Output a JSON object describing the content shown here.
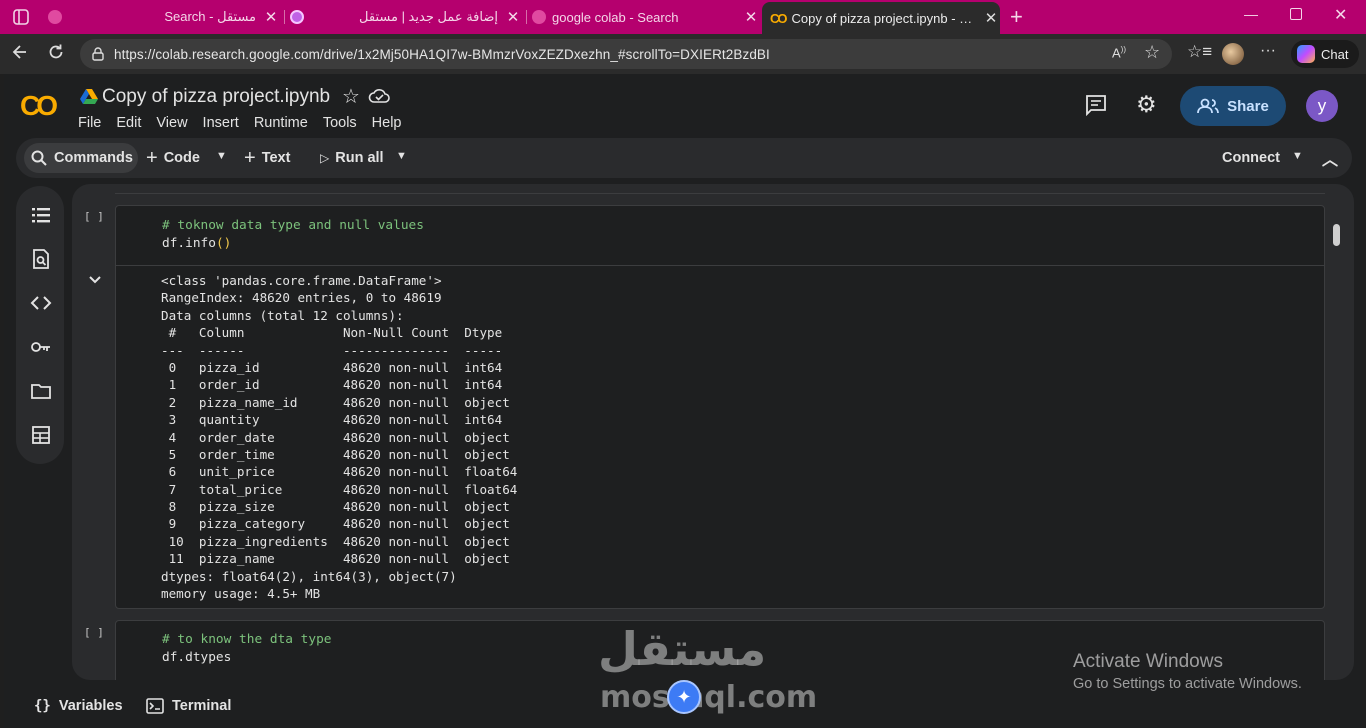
{
  "browser": {
    "tabs": [
      {
        "title": "Search - مستقل",
        "active": false
      },
      {
        "title": "إضافة عمل جديد | مستقل",
        "active": false
      },
      {
        "title": "google colab - Search",
        "active": false
      },
      {
        "title": "Copy of pizza project.ipynb - Colab",
        "active": true
      }
    ],
    "url": "https://colab.research.google.com/drive/1x2Mj50HA1QI7w-BMmzrVoxZEZDxezhn_#scrollTo=DXIERt2BzdBI",
    "chat_label": "Chat",
    "accent_color": "#b5006e"
  },
  "colab": {
    "logo": "CO",
    "notebook_title": "Copy of pizza project.ipynb",
    "menu": [
      "File",
      "Edit",
      "View",
      "Insert",
      "Runtime",
      "Tools",
      "Help"
    ],
    "share_label": "Share",
    "avatar_letter": "y",
    "toolbar": {
      "commands": "Commands",
      "code": "Code",
      "text": "Text",
      "run_all": "Run all",
      "connect": "Connect"
    },
    "cells": [
      {
        "run_marker": "[ ]",
        "comment": "# toknow data type and null values",
        "code_name": "df.info",
        "code_paren": "()",
        "output": [
          "<class 'pandas.core.frame.DataFrame'>",
          "RangeIndex: 48620 entries, 0 to 48619",
          "Data columns (total 12 columns):",
          " #   Column             Non-Null Count  Dtype  ",
          "---  ------             --------------  -----  ",
          " 0   pizza_id           48620 non-null  int64  ",
          " 1   order_id           48620 non-null  int64  ",
          " 2   pizza_name_id      48620 non-null  object ",
          " 3   quantity           48620 non-null  int64  ",
          " 4   order_date         48620 non-null  object ",
          " 5   order_time         48620 non-null  object ",
          " 6   unit_price         48620 non-null  float64",
          " 7   total_price        48620 non-null  float64",
          " 8   pizza_size         48620 non-null  object ",
          " 9   pizza_category     48620 non-null  object ",
          " 10  pizza_ingredients  48620 non-null  object ",
          " 11  pizza_name         48620 non-null  object ",
          "dtypes: float64(2), int64(3), object(7)",
          "memory usage: 4.5+ MB"
        ]
      },
      {
        "run_marker": "[ ]",
        "comment": "# to know the dta type",
        "code_name": "df.dtypes"
      }
    ],
    "bottom": {
      "variables": "Variables",
      "terminal": "Terminal"
    }
  },
  "overlay": {
    "activate_title": "Activate Windows",
    "activate_sub": "Go to Settings to activate Windows.",
    "watermark_arabic": "مستقل",
    "watermark_latin": "mostaql.com"
  }
}
